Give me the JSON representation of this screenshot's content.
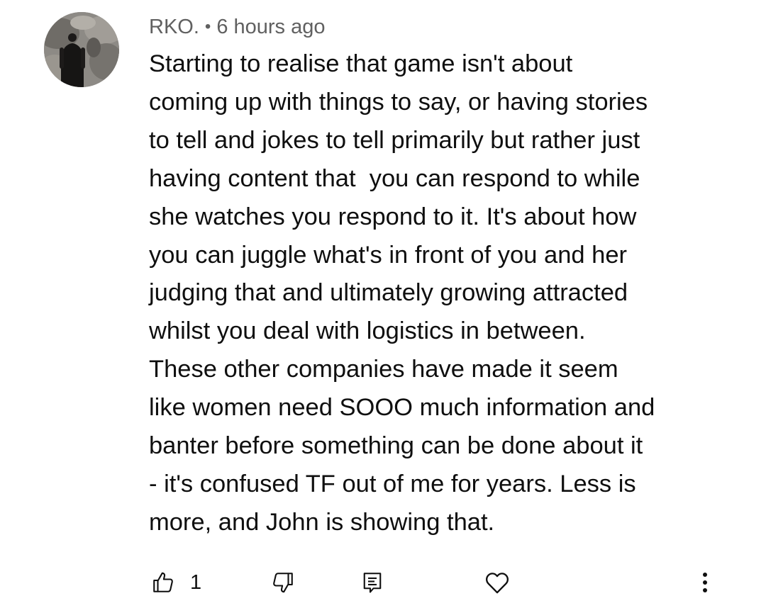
{
  "comment": {
    "author": "RKO.",
    "separator": "•",
    "timestamp": "6 hours ago",
    "lines": [
      "Starting to realise that game isn't about",
      "coming up with things to say, or having stories",
      "to tell and jokes to tell primarily but rather just",
      "having content that  you can respond to while",
      "she watches you respond to it. It's about how",
      "you can juggle what's in front of you and her",
      "judging that and ultimately growing attracted",
      "whilst you deal with logistics in between.",
      "These other companies have made it seem",
      "like women need SOOO much information and",
      "banter before something can be done about it",
      "- it's confused TF out of me for years. Less is",
      "more, and John is showing that."
    ],
    "like_count": "1"
  },
  "icons": {
    "avatar": "avatar-photo",
    "like": "thumbs-up-icon",
    "dislike": "thumbs-down-icon",
    "reply": "reply-comment-icon",
    "heart": "heart-icon",
    "more": "more-vertical-icon"
  },
  "colors": {
    "text_primary": "#0f0f0f",
    "text_secondary": "#606060",
    "icon": "#0f0f0f",
    "background": "#ffffff"
  }
}
